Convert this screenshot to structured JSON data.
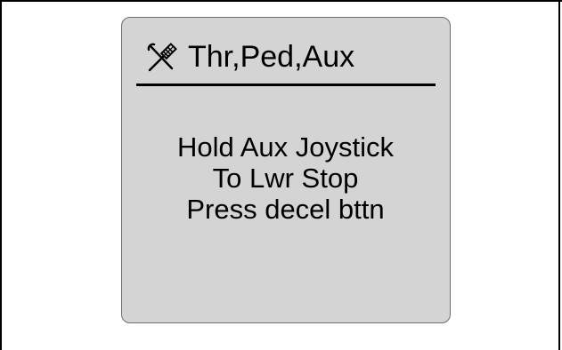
{
  "screen": {
    "header": {
      "icon": "tools-icon",
      "title": "Thr,Ped,Aux"
    },
    "message": {
      "lines": [
        "Hold Aux Joystick",
        "To Lwr Stop",
        "Press decel bttn"
      ]
    }
  },
  "colors": {
    "screen_background": "#d4d4d4",
    "screen_border": "#6e6e6e",
    "text": "#000000",
    "page_background": "#ffffff"
  }
}
